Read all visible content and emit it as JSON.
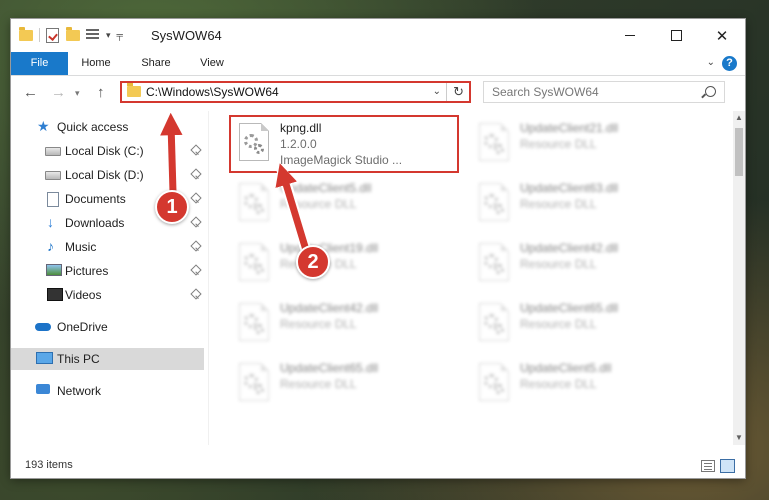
{
  "window": {
    "title": "SysWOW64",
    "controls": {
      "minimize": "—",
      "maximize": "☐",
      "close": "✕"
    }
  },
  "ribbon": {
    "tabs": [
      "File",
      "Home",
      "Share",
      "View"
    ],
    "help": "?"
  },
  "address": {
    "path": "C:\\Windows\\SysWOW64",
    "search_placeholder": "Search SysWOW64"
  },
  "nav_pane": {
    "items": [
      {
        "label": "Quick access",
        "icon": "star-icon",
        "pinned": false
      },
      {
        "label": "Local Disk (C:)",
        "icon": "drive-icon",
        "pinned": true
      },
      {
        "label": "Local Disk (D:)",
        "icon": "drive-icon",
        "pinned": true
      },
      {
        "label": "Documents",
        "icon": "document-icon",
        "pinned": true
      },
      {
        "label": "Downloads",
        "icon": "download-icon",
        "pinned": true
      },
      {
        "label": "Music",
        "icon": "music-icon",
        "pinned": true
      },
      {
        "label": "Pictures",
        "icon": "pictures-icon",
        "pinned": true
      },
      {
        "label": "Videos",
        "icon": "video-icon",
        "pinned": true
      },
      {
        "label": "OneDrive",
        "icon": "cloud-icon",
        "pinned": false
      },
      {
        "label": "This PC",
        "icon": "computer-icon",
        "pinned": false,
        "selected": true
      },
      {
        "label": "Network",
        "icon": "network-icon",
        "pinned": false
      }
    ]
  },
  "files": [
    {
      "name": "kpng.dll",
      "line1": "1.2.0.0",
      "line2": "ImageMagick Studio ...",
      "highlighted": true
    },
    {
      "name": "UpdateClient21.dll",
      "line1": "Resource DLL",
      "line2": ""
    },
    {
      "name": "UpdateClient5.dll",
      "line1": "Resource DLL",
      "line2": ""
    },
    {
      "name": "UpdateClient63.dll",
      "line1": "Resource DLL",
      "line2": ""
    },
    {
      "name": "UpdateClient19.dll",
      "line1": "Resource DLL",
      "line2": ""
    },
    {
      "name": "UpdateClient42.dll",
      "line1": "Resource DLL",
      "line2": ""
    },
    {
      "name": "UpdateClient42.dll",
      "line1": "Resource DLL",
      "line2": ""
    },
    {
      "name": "UpdateClient65.dll",
      "line1": "Resource DLL",
      "line2": ""
    },
    {
      "name": "UpdateClient65.dll",
      "line1": "Resource DLL",
      "line2": ""
    },
    {
      "name": "UpdateClient5.dll",
      "line1": "Resource DLL",
      "line2": ""
    }
  ],
  "status": {
    "items_count": "193 items"
  },
  "annotations": {
    "badge1": "1",
    "badge2": "2",
    "color": "#d4382f"
  },
  "colors": {
    "accent": "#1979ca",
    "annotation": "#d4382f"
  }
}
